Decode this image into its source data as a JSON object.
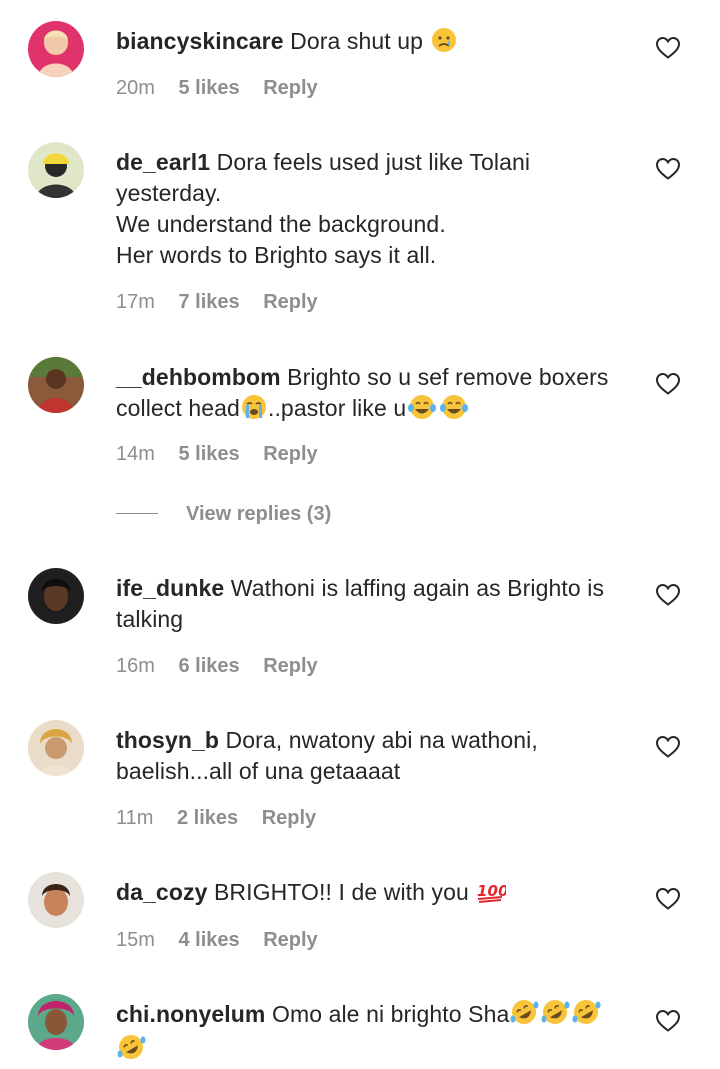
{
  "comments": [
    {
      "username": "biancyskincare",
      "text": "Dora shut up",
      "emoji": [
        "sad-tear-emoji"
      ],
      "time": "20m",
      "likes": "5 likes",
      "reply": "Reply"
    },
    {
      "username": "de_earl1",
      "text": "Dora feels used just like Tolani yesterday.\nWe understand the background.\nHer words to Brighto says it all.",
      "time": "17m",
      "likes": "7 likes",
      "reply": "Reply"
    },
    {
      "username": "__dehbombom",
      "text_a": "Brighto so u sef remove boxers collect head",
      "text_b": "..pastor like u",
      "emoji": [
        "loudly-crying-emoji",
        "tears-of-joy-emoji",
        "tears-of-joy-emoji"
      ],
      "time": "14m",
      "likes": "5 likes",
      "reply": "Reply",
      "view_replies": "View replies (3)"
    },
    {
      "username": "ife_dunke",
      "text": "Wathoni is laffing again as Brighto is talking",
      "time": "16m",
      "likes": "6 likes",
      "reply": "Reply"
    },
    {
      "username": "thosyn_b",
      "text": "Dora, nwatony abi na wathoni, baelish...all of una getaaaat",
      "time": "11m",
      "likes": "2 likes",
      "reply": "Reply"
    },
    {
      "username": "da_cozy",
      "text": "BRIGHTO!! I de with you",
      "emoji": [
        "hundred-points-emoji"
      ],
      "time": "15m",
      "likes": "4 likes",
      "reply": "Reply"
    },
    {
      "username": "chi.nonyelum",
      "text": "Omo ale ni brighto Sha",
      "emoji": [
        "rofl-emoji",
        "rofl-emoji",
        "rofl-emoji",
        "rofl-emoji"
      ]
    }
  ],
  "icons": {
    "like": "heart-outline-icon"
  },
  "colors": {
    "text": "#262626",
    "meta": "#8e8e8e",
    "background": "#ffffff"
  }
}
